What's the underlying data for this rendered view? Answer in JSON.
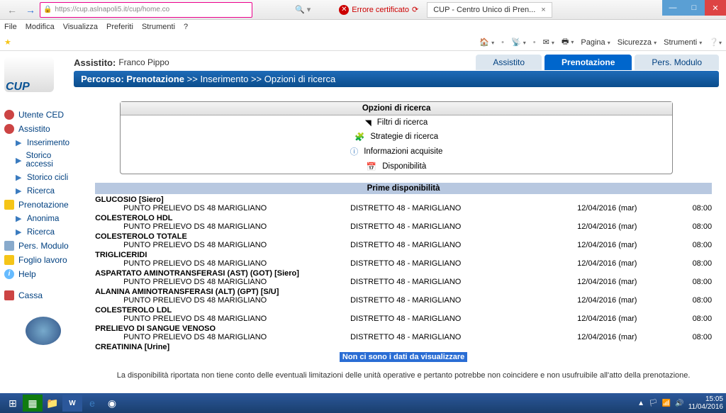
{
  "window": {
    "url_display": "https://cup.aslnapoli5.it/cup/home.co",
    "cert_error": "Errore certificato",
    "tab_title": "CUP - Centro Unico di Pren...",
    "menu": [
      "File",
      "Modifica",
      "Visualizza",
      "Preferiti",
      "Strumenti",
      "?"
    ],
    "cmd_pagina": "Pagina",
    "cmd_sicurezza": "Sicurezza",
    "cmd_strumenti": "Strumenti"
  },
  "sidebar": {
    "logo": "CUP",
    "items": [
      {
        "label": "Utente CED",
        "icon": "ico-user"
      },
      {
        "label": "Assistito",
        "icon": "ico-user",
        "subs": [
          "Inserimento",
          "Storico accessi",
          "Storico cicli",
          "Ricerca"
        ]
      },
      {
        "label": "Prenotazione",
        "icon": "ico-doc",
        "subs": [
          "Anonima",
          "Ricerca"
        ]
      },
      {
        "label": "Pers. Modulo",
        "icon": "ico-page"
      },
      {
        "label": "Foglio lavoro",
        "icon": "ico-doc"
      },
      {
        "label": "Help",
        "icon": "ico-info"
      },
      {
        "label": "Cassa",
        "icon": "ico-cassa"
      }
    ]
  },
  "header": {
    "assistito_label": "Assistito:",
    "assistito_name": "Franco Pippo",
    "tabs": [
      "Assistito",
      "Prenotazione",
      "Pers. Modulo"
    ],
    "active_tab": 1,
    "percorso_label": "Percorso: Prenotazione",
    "percorso_tail": " >> Inserimento >> Opzioni di ricerca"
  },
  "options": {
    "title": "Opzioni di ricerca",
    "items": [
      "Filtri di ricerca",
      "Strategie di ricerca",
      "Informazioni acquisite",
      "Disponibilità"
    ]
  },
  "availability": {
    "title": "Prime disponibilità",
    "rows": [
      {
        "group": "GLUCOSIO [Siero]",
        "loc": "PUNTO PRELIEVO DS 48 MARIGLIANO",
        "district": "DISTRETTO 48 - MARIGLIANO",
        "date": "12/04/2016 (mar)",
        "time": "08:00"
      },
      {
        "group": "COLESTEROLO HDL",
        "loc": "PUNTO PRELIEVO DS 48 MARIGLIANO",
        "district": "DISTRETTO 48 - MARIGLIANO",
        "date": "12/04/2016 (mar)",
        "time": "08:00"
      },
      {
        "group": "COLESTEROLO TOTALE",
        "loc": "PUNTO PRELIEVO DS 48 MARIGLIANO",
        "district": "DISTRETTO 48 - MARIGLIANO",
        "date": "12/04/2016 (mar)",
        "time": "08:00"
      },
      {
        "group": "TRIGLICERIDI",
        "loc": "PUNTO PRELIEVO DS 48 MARIGLIANO",
        "district": "DISTRETTO 48 - MARIGLIANO",
        "date": "12/04/2016 (mar)",
        "time": "08:00"
      },
      {
        "group": "ASPARTATO AMINOTRANSFERASI (AST) (GOT) [Siero]",
        "loc": "PUNTO PRELIEVO DS 48 MARIGLIANO",
        "district": "DISTRETTO 48 - MARIGLIANO",
        "date": "12/04/2016 (mar)",
        "time": "08:00"
      },
      {
        "group": "ALANINA AMINOTRANSFERASI (ALT) (GPT) [S/U]",
        "loc": "PUNTO PRELIEVO DS 48 MARIGLIANO",
        "district": "DISTRETTO 48 - MARIGLIANO",
        "date": "12/04/2016 (mar)",
        "time": "08:00"
      },
      {
        "group": "COLESTEROLO LDL",
        "loc": "PUNTO PRELIEVO DS 48 MARIGLIANO",
        "district": "DISTRETTO 48 - MARIGLIANO",
        "date": "12/04/2016 (mar)",
        "time": "08:00"
      },
      {
        "group": "PRELIEVO DI SANGUE VENOSO",
        "loc": "PUNTO PRELIEVO DS 48 MARIGLIANO",
        "district": "DISTRETTO 48 - MARIGLIANO",
        "date": "12/04/2016 (mar)",
        "time": "08:00"
      },
      {
        "group": "CREATININA [Urine]",
        "no_data": "Non ci sono i dati da visualizzare"
      }
    ],
    "disclaimer": "La disponibilità riportata non tiene conto delle eventuali limitazioni delle unità operative e pertanto potrebbe non coincidere e non usufruibile all'atto della prenotazione."
  },
  "taskbar": {
    "time": "15:05",
    "date": "11/04/2016"
  }
}
